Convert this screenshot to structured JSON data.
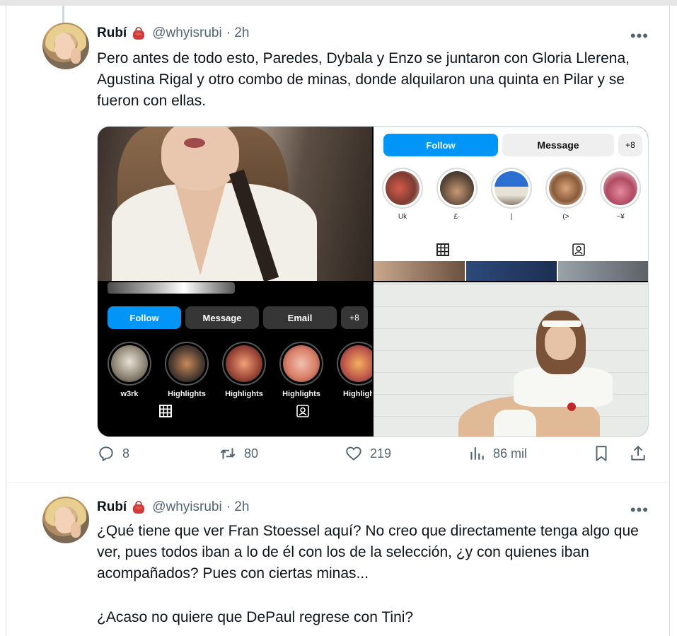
{
  "tweets": [
    {
      "name": "Rubí",
      "handle": "@whyisrubi",
      "time": "· 2h",
      "more": "•••",
      "text": "Pero antes de todo esto, Paredes, Dybala y Enzo se juntaron con Gloria Llerena, Agustina Rigal y otro combo de minas, donde alquilaron una quinta en Pilar y se fueron con ellas.",
      "media": {
        "light_profile": {
          "follow": "Follow",
          "message": "Message",
          "add": "+8",
          "highlights": [
            "Uk",
            "£·",
            "|",
            "(>",
            "~¥"
          ]
        },
        "dark_profile": {
          "follow": "Follow",
          "message": "Message",
          "email": "Email",
          "add": "+8",
          "highlights": [
            "w3rk",
            "Highlights",
            "Highlights",
            "Highlights",
            "Highligh"
          ]
        }
      },
      "stats": {
        "replies": "8",
        "retweets": "80",
        "likes": "219",
        "views": "86 mil"
      }
    },
    {
      "name": "Rubí",
      "handle": "@whyisrubi",
      "time": "· 2h",
      "more": "•••",
      "text_p1": "¿Qué tiene que ver Fran Stoessel aquí? No creo que directamente tenga algo que ver, pues todos iban a lo de él con los de la selección, ¿y con quienes iban acompañados? Pues con ciertas minas...",
      "text_p2": "¿Acaso no quiere que DePaul regrese con Tini?"
    }
  ],
  "icons": {
    "badge": "red-bag-icon",
    "reply": "reply-icon",
    "retweet": "retweet-icon",
    "like": "heart-icon",
    "views": "views-icon",
    "bookmark": "bookmark-icon",
    "share": "share-icon",
    "grid": "grid-icon",
    "tagged": "tagged-icon"
  },
  "colors": {
    "text": "#0f1419",
    "secondary": "#536471",
    "ig_blue": "#0095f6",
    "badge_red": "#d23a3a"
  }
}
